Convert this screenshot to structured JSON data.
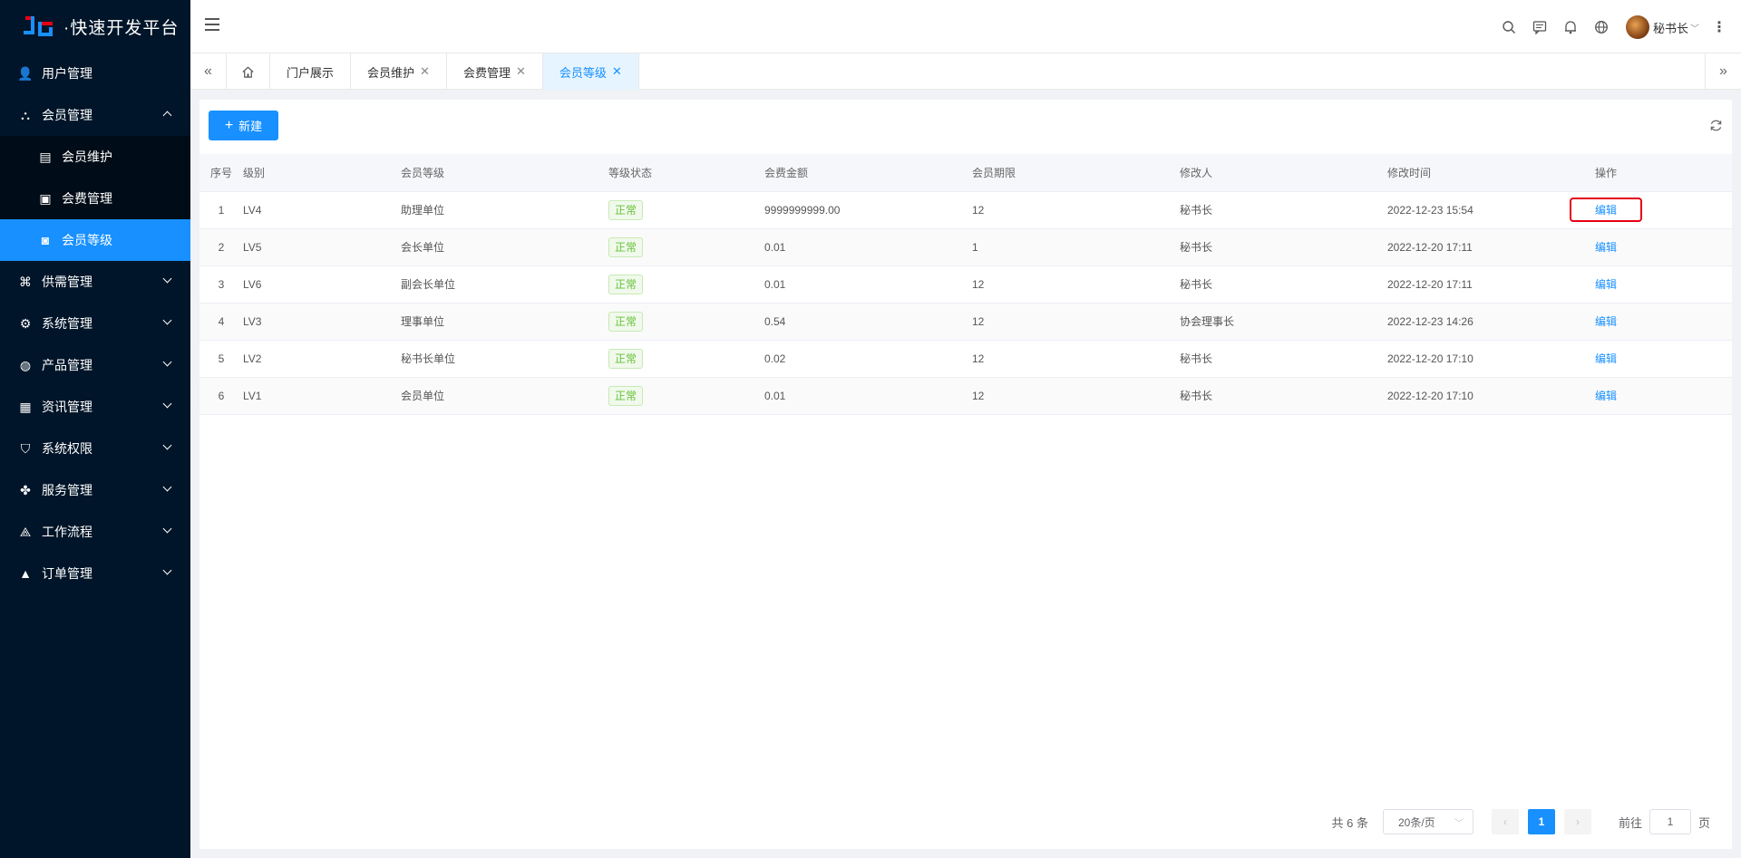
{
  "app": {
    "title": "·快速开发平台"
  },
  "sidebar": {
    "items": [
      {
        "label": "用户管理",
        "icon": "user-icon"
      },
      {
        "label": "会员管理",
        "icon": "members-icon",
        "expanded": true,
        "children": [
          {
            "label": "会员维护",
            "icon": "table-icon"
          },
          {
            "label": "会费管理",
            "icon": "fee-icon"
          },
          {
            "label": "会员等级",
            "icon": "level-icon",
            "active": true
          }
        ]
      },
      {
        "label": "供需管理",
        "icon": "supply-icon"
      },
      {
        "label": "系统管理",
        "icon": "settings-icon"
      },
      {
        "label": "产品管理",
        "icon": "product-icon"
      },
      {
        "label": "资讯管理",
        "icon": "news-icon"
      },
      {
        "label": "系统权限",
        "icon": "shield-icon"
      },
      {
        "label": "服务管理",
        "icon": "service-icon"
      },
      {
        "label": "工作流程",
        "icon": "workflow-icon"
      },
      {
        "label": "订单管理",
        "icon": "order-icon"
      }
    ]
  },
  "header": {
    "username": "秘书长",
    "icons": [
      "search-icon",
      "message-icon",
      "bell-icon",
      "globe-icon"
    ]
  },
  "tabs": [
    {
      "label": "门户展示",
      "closable": false
    },
    {
      "label": "会员维护",
      "closable": true
    },
    {
      "label": "会费管理",
      "closable": true
    },
    {
      "label": "会员等级",
      "closable": true,
      "active": true
    }
  ],
  "toolbar": {
    "add_label": "新建"
  },
  "table": {
    "columns": [
      "序号",
      "级别",
      "会员等级",
      "等级状态",
      "会费金额",
      "会员期限",
      "修改人",
      "修改时间",
      "操作"
    ],
    "rows": [
      {
        "idx": "1",
        "level": "LV4",
        "grade": "助理单位",
        "status": "正常",
        "fee": "9999999999.00",
        "term": "12",
        "modifier": "秘书长",
        "time": "2022-12-23 15:54",
        "action": "编辑"
      },
      {
        "idx": "2",
        "level": "LV5",
        "grade": "会长单位",
        "status": "正常",
        "fee": "0.01",
        "term": "1",
        "modifier": "秘书长",
        "time": "2022-12-20 17:11",
        "action": "编辑"
      },
      {
        "idx": "3",
        "level": "LV6",
        "grade": "副会长单位",
        "status": "正常",
        "fee": "0.01",
        "term": "12",
        "modifier": "秘书长",
        "time": "2022-12-20 17:11",
        "action": "编辑"
      },
      {
        "idx": "4",
        "level": "LV3",
        "grade": "理事单位",
        "status": "正常",
        "fee": "0.54",
        "term": "12",
        "modifier": "协会理事长",
        "time": "2022-12-23 14:26",
        "action": "编辑"
      },
      {
        "idx": "5",
        "level": "LV2",
        "grade": "秘书长单位",
        "status": "正常",
        "fee": "0.02",
        "term": "12",
        "modifier": "秘书长",
        "time": "2022-12-20 17:10",
        "action": "编辑"
      },
      {
        "idx": "6",
        "level": "LV1",
        "grade": "会员单位",
        "status": "正常",
        "fee": "0.01",
        "term": "12",
        "modifier": "秘书长",
        "time": "2022-12-20 17:10",
        "action": "编辑"
      }
    ]
  },
  "pagination": {
    "total_text": "共 6 条",
    "page_size": "20条/页",
    "current_page": "1",
    "goto_label": "前往",
    "goto_value": "1",
    "goto_suffix": "页"
  },
  "colors": {
    "sidebar_bg": "#001529",
    "accent": "#1890ff",
    "status_green": "#67c23a",
    "highlight_red": "#e60012"
  }
}
